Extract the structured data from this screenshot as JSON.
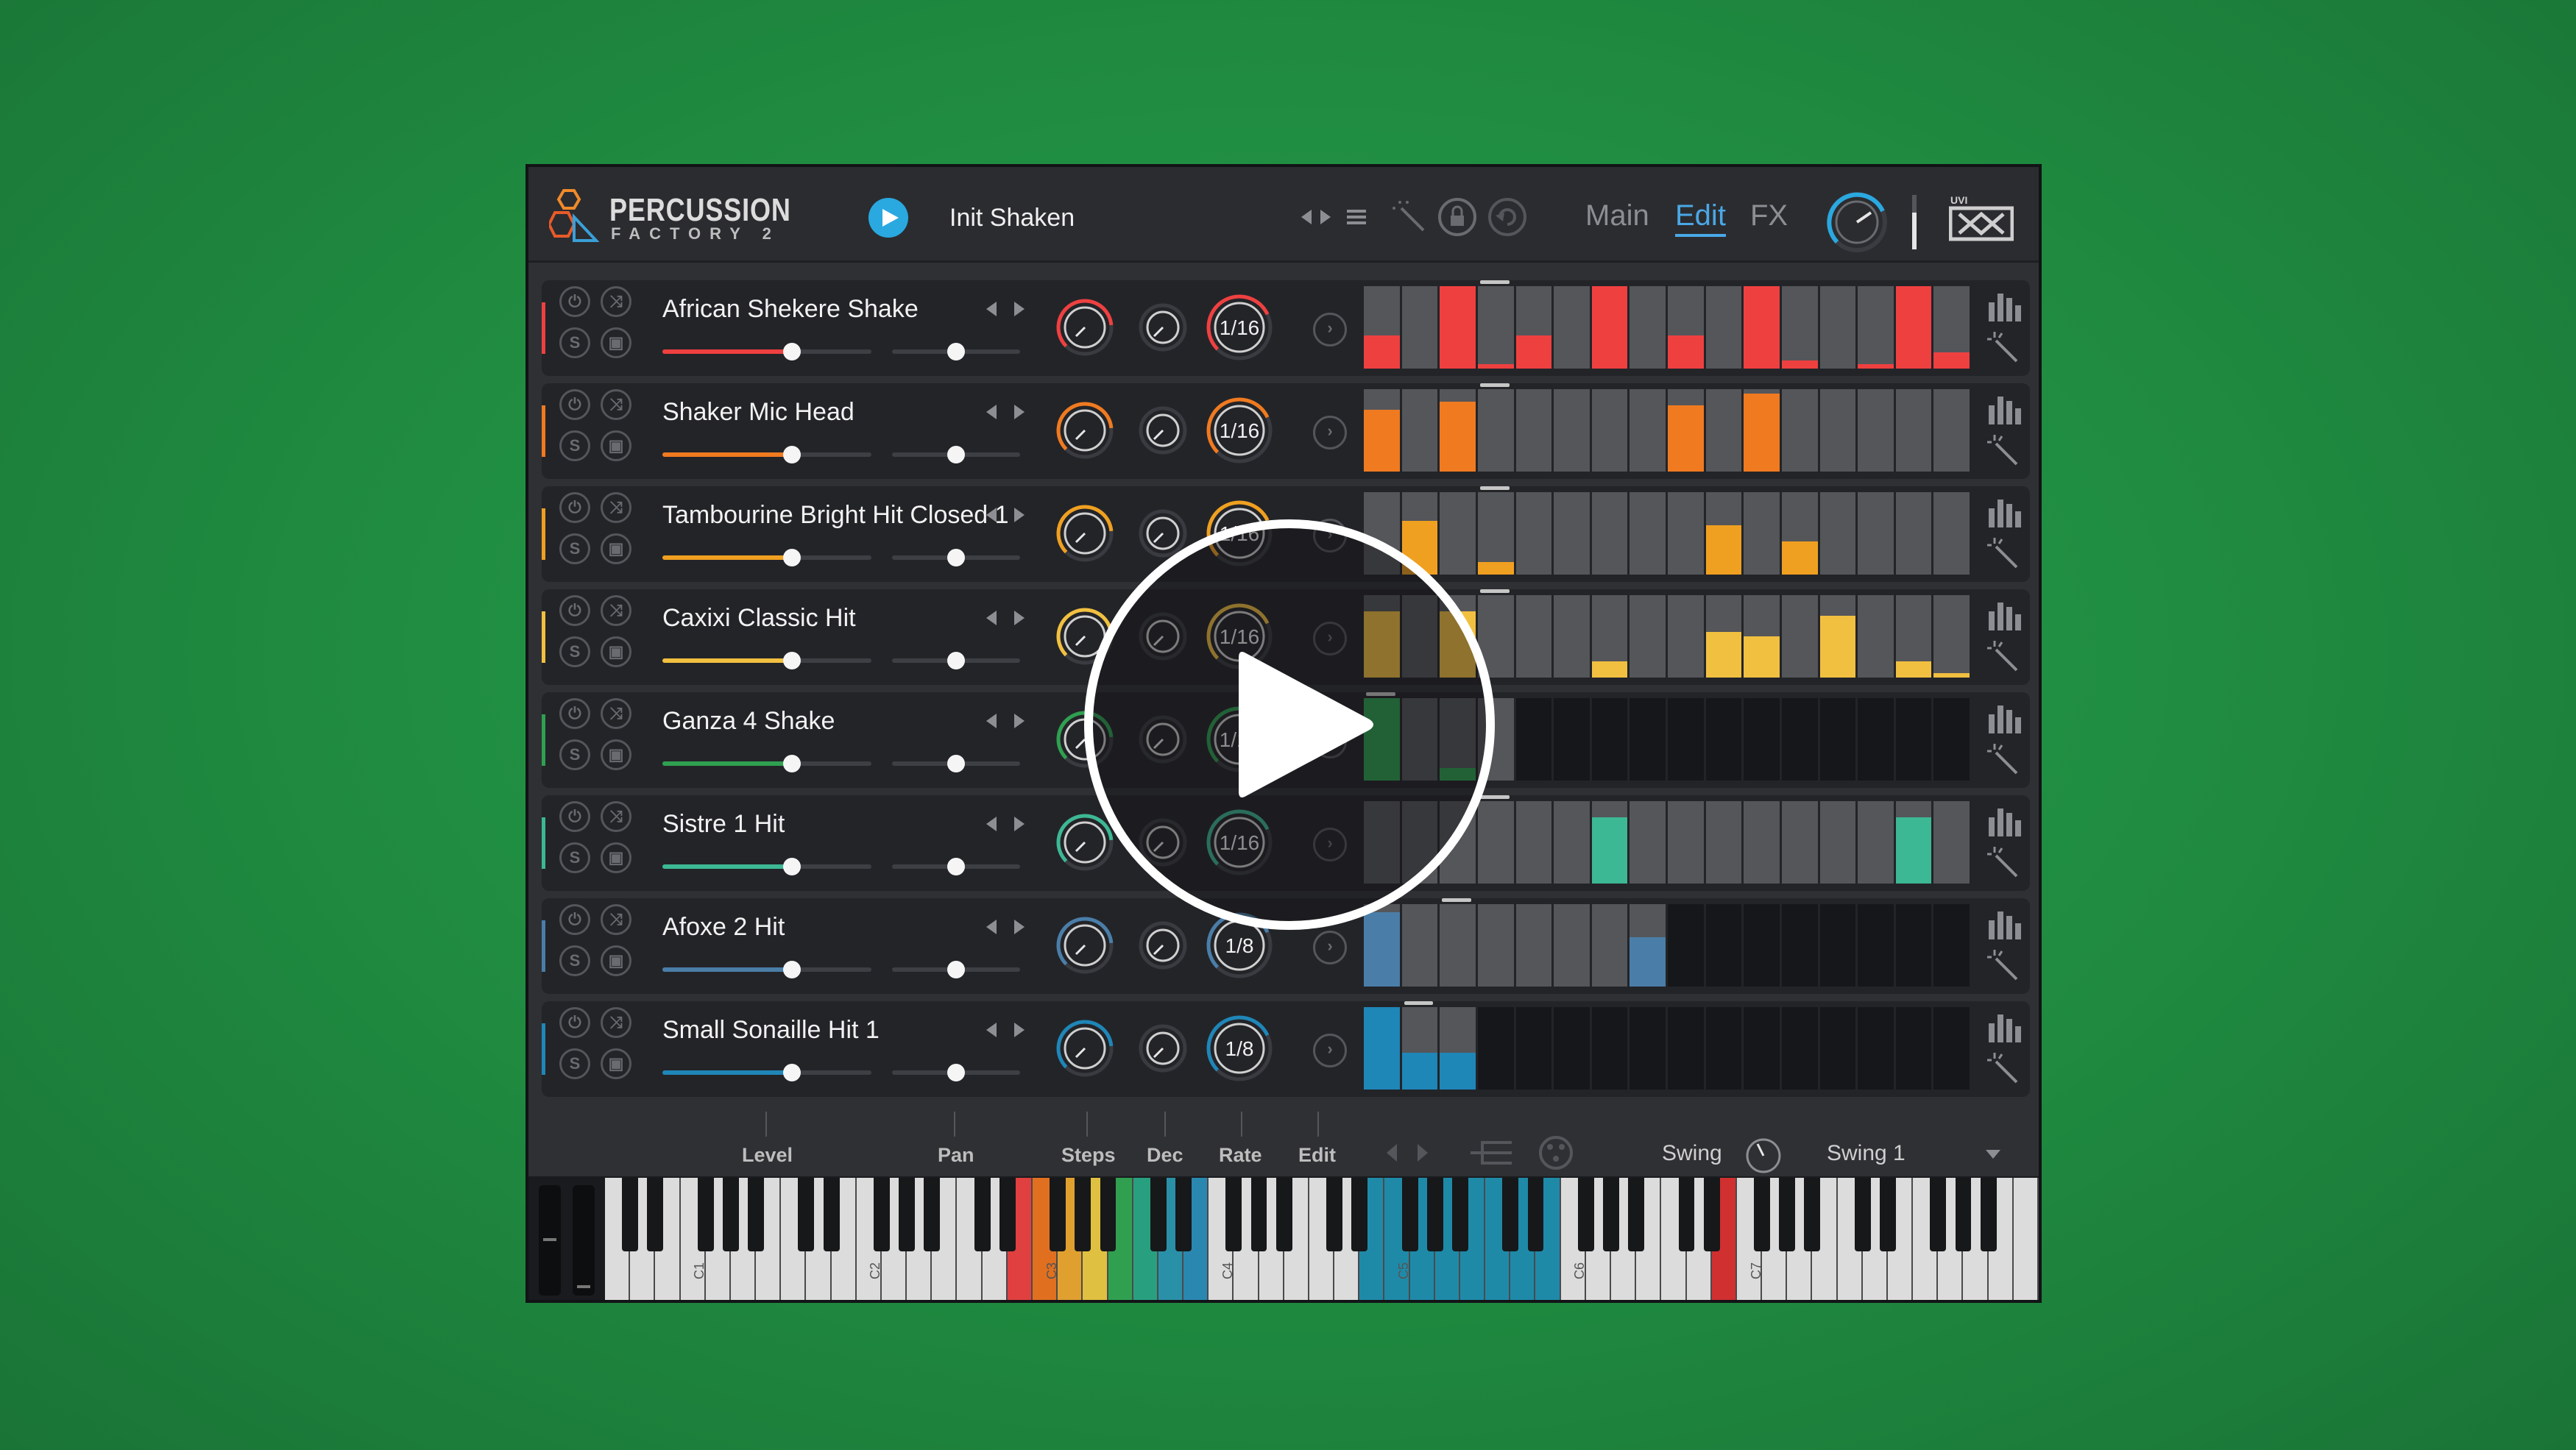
{
  "app": {
    "logo_title": "PERCUSSION",
    "logo_subtitle": "FACTORY 2",
    "preset_name": "Init Shaken",
    "tabs": [
      {
        "label": "Main",
        "active": false
      },
      {
        "label": "Edit",
        "active": true
      },
      {
        "label": "FX",
        "active": false
      }
    ],
    "brand": "UVI"
  },
  "colors": {
    "accent": "#4aa8e6",
    "play": "#2aa8e0",
    "row_colors": [
      "#ef4040",
      "#f07a20",
      "#f0a020",
      "#f2c040",
      "#2fa050",
      "#3cb894",
      "#4a7ea8",
      "#1f86b8"
    ]
  },
  "rows": [
    {
      "name": "African Shekere Shake",
      "color": "#ef4040",
      "level": 0.62,
      "pan": 0.5,
      "rate": "1/16",
      "steps": 16,
      "active_steps": 16,
      "start": 4,
      "values": [
        0.4,
        0,
        1,
        0.05,
        0.4,
        0,
        1,
        0,
        0.4,
        0,
        1,
        0.1,
        0,
        0.05,
        1,
        0.2
      ]
    },
    {
      "name": "Shaker Mic Head",
      "color": "#f07a20",
      "level": 0.62,
      "pan": 0.5,
      "rate": "1/16",
      "steps": 16,
      "active_steps": 16,
      "start": 4,
      "values": [
        0.75,
        0,
        0.85,
        0,
        0,
        0,
        0,
        0,
        0.8,
        0,
        0.95,
        0,
        0,
        0,
        0,
        0
      ]
    },
    {
      "name": "Tambourine Bright Hit Closed 1",
      "color": "#f0a020",
      "level": 0.62,
      "pan": 0.5,
      "rate": "1/16",
      "steps": 16,
      "active_steps": 16,
      "start": 4,
      "values": [
        0,
        0.65,
        0,
        0.15,
        0,
        0,
        0,
        0,
        0,
        0.6,
        0,
        0.4,
        0,
        0,
        0,
        0
      ]
    },
    {
      "name": "Caxixi Classic Hit",
      "color": "#f2c040",
      "level": 0.62,
      "pan": 0.5,
      "rate": "1/16",
      "steps": 16,
      "active_steps": 16,
      "start": 4,
      "values": [
        0.8,
        0,
        0.8,
        0,
        0,
        0,
        0.2,
        0,
        0,
        0.55,
        0.5,
        0,
        0.75,
        0,
        0.2,
        0.05
      ]
    },
    {
      "name": "Ganza 4 Shake",
      "color": "#2fa050",
      "level": 0.62,
      "pan": 0.5,
      "rate": "1/16",
      "steps": 16,
      "active_steps": 4,
      "start": 1,
      "values": [
        1,
        0,
        0.15,
        0,
        0,
        0,
        0,
        0,
        0,
        0,
        0,
        0,
        0,
        0,
        0,
        0
      ]
    },
    {
      "name": "Sistre 1 Hit",
      "color": "#3cb894",
      "level": 0.62,
      "pan": 0.5,
      "rate": "1/16",
      "steps": 16,
      "active_steps": 16,
      "start": 4,
      "values": [
        0,
        0,
        0,
        0,
        0,
        0,
        0.8,
        0,
        0,
        0,
        0,
        0,
        0,
        0,
        0.8,
        0
      ]
    },
    {
      "name": "Afoxe 2 Hit",
      "color": "#4a7ea8",
      "level": 0.62,
      "pan": 0.5,
      "rate": "1/8",
      "steps": 16,
      "active_steps": 8,
      "start": 3,
      "values": [
        0.9,
        0,
        0,
        0,
        0,
        0,
        0,
        0.6,
        0,
        0,
        0,
        0,
        0,
        0,
        0,
        0
      ]
    },
    {
      "name": "Small Sonaille Hit 1",
      "color": "#1f86b8",
      "level": 0.62,
      "pan": 0.5,
      "rate": "1/8",
      "steps": 16,
      "active_steps": 3,
      "start": 2,
      "values": [
        1,
        0.45,
        0.45,
        0,
        0,
        0,
        0,
        0,
        0,
        0,
        0,
        0,
        0,
        0,
        0,
        0
      ]
    }
  ],
  "footer": {
    "level_label": "Level",
    "pan_label": "Pan",
    "steps_label": "Steps",
    "dec_label": "Dec",
    "rate_label": "Rate",
    "edit_label": "Edit",
    "swing_label": "Swing",
    "swing_value": "Swing 1"
  },
  "keyboard": {
    "octave_labels": [
      "C1",
      "C2",
      "C3",
      "C4",
      "C5",
      "C6",
      "C7"
    ]
  },
  "icons": [
    "power-icon",
    "shuffle-icon",
    "solo-icon",
    "lock-icon",
    "arrow-left-icon",
    "arrow-right-icon",
    "chevron-right-icon",
    "bars-icon",
    "wand-icon",
    "menu-icon",
    "undo-icon",
    "dice-icon",
    "fork-icon",
    "play-icon"
  ]
}
